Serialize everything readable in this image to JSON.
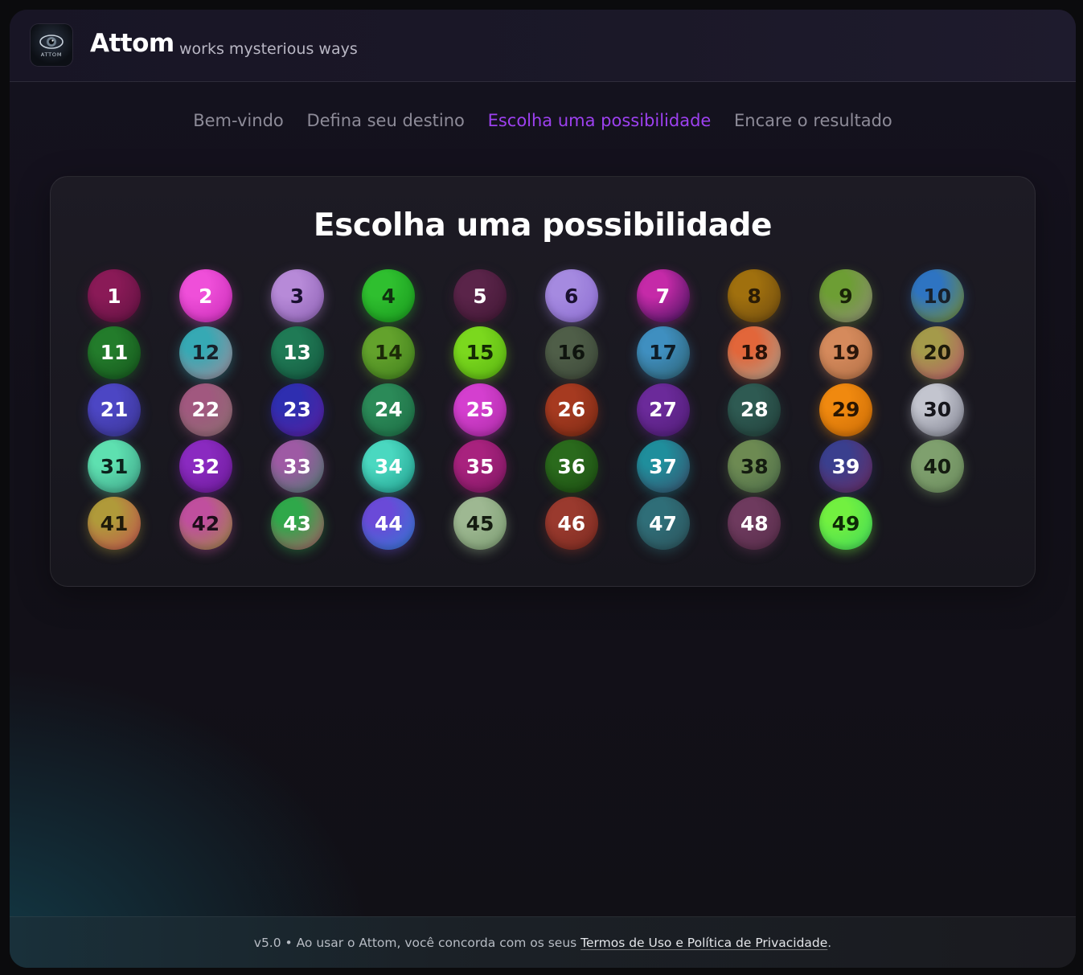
{
  "header": {
    "title": "Attom",
    "tagline": "works mysterious ways",
    "logo_text": "ATTOM"
  },
  "steps": [
    {
      "label": "Bem-vindo",
      "active": false
    },
    {
      "label": "Defina seu destino",
      "active": false
    },
    {
      "label": "Escolha uma possibilidade",
      "active": true
    },
    {
      "label": "Encare o resultado",
      "active": false
    }
  ],
  "main": {
    "title": "Escolha uma possibilidade",
    "balls": [
      {
        "number": "1",
        "colors": [
          "#8a1a57",
          "#5e1240"
        ],
        "text": "#ffffff"
      },
      {
        "number": "2",
        "colors": [
          "#ef4fd9",
          "#c72bb6"
        ],
        "text": "#ffffff"
      },
      {
        "number": "3",
        "colors": [
          "#b78ad8",
          "#8a5fb1"
        ],
        "text": "#1a1030"
      },
      {
        "number": "4",
        "colors": [
          "#2fbf2f",
          "#17961c"
        ],
        "text": "#103010"
      },
      {
        "number": "5",
        "colors": [
          "#5a2449",
          "#3f1733"
        ],
        "text": "#ffffff"
      },
      {
        "number": "6",
        "colors": [
          "#a58ae0",
          "#8b6cd0"
        ],
        "text": "#1a1030"
      },
      {
        "number": "7",
        "colors": [
          "#c52aa8",
          "#3b1258"
        ],
        "text": "#ffffff"
      },
      {
        "number": "8",
        "colors": [
          "#a0700e",
          "#6d4a10"
        ],
        "text": "#2a1c06"
      },
      {
        "number": "9",
        "colors": [
          "#6d9e34",
          "#8f8b78"
        ],
        "text": "#1a2208"
      },
      {
        "number": "10",
        "colors": [
          "#2e74c2",
          "#7a8e2a"
        ],
        "text": "#18202a"
      },
      {
        "number": "11",
        "colors": [
          "#237c2b",
          "#15531c"
        ],
        "text": "#ffffff"
      },
      {
        "number": "12",
        "colors": [
          "#36a9b4",
          "#a48a9a"
        ],
        "text": "#18202a"
      },
      {
        "number": "13",
        "colors": [
          "#1f7a55",
          "#14553d"
        ],
        "text": "#ffffff"
      },
      {
        "number": "14",
        "colors": [
          "#63a22c",
          "#3f7d1c"
        ],
        "text": "#1c2a08"
      },
      {
        "number": "15",
        "colors": [
          "#7bd81e",
          "#56b010"
        ],
        "text": "#142a04"
      },
      {
        "number": "16",
        "colors": [
          "#4f5e48",
          "#3b4638"
        ],
        "text": "#0f140e"
      },
      {
        "number": "17",
        "colors": [
          "#3f8fc0",
          "#2d5f6e"
        ],
        "text": "#0e1c26"
      },
      {
        "number": "18",
        "colors": [
          "#e2663a",
          "#a9a08f"
        ],
        "text": "#2a1208"
      },
      {
        "number": "19",
        "colors": [
          "#d58a5c",
          "#b06e45"
        ],
        "text": "#2a160a"
      },
      {
        "number": "20",
        "colors": [
          "#a49a4a",
          "#b5556a"
        ],
        "text": "#1e1a0a"
      },
      {
        "number": "21",
        "colors": [
          "#4c46c4",
          "#3a348f"
        ],
        "text": "#ffffff"
      },
      {
        "number": "22",
        "colors": [
          "#a1587f",
          "#8a6f70"
        ],
        "text": "#ffffff"
      },
      {
        "number": "23",
        "colors": [
          "#2e2eb0",
          "#5a1e9c"
        ],
        "text": "#ffffff"
      },
      {
        "number": "24",
        "colors": [
          "#2b8a58",
          "#1c6a43"
        ],
        "text": "#ffffff"
      },
      {
        "number": "25",
        "colors": [
          "#d43fcf",
          "#a82aa2"
        ],
        "text": "#ffffff"
      },
      {
        "number": "26",
        "colors": [
          "#a63a20",
          "#7a2a14"
        ],
        "text": "#ffffff"
      },
      {
        "number": "27",
        "colors": [
          "#6b2a9a",
          "#4e1c73"
        ],
        "text": "#ffffff"
      },
      {
        "number": "28",
        "colors": [
          "#2e5a52",
          "#223f3a"
        ],
        "text": "#ffffff"
      },
      {
        "number": "29",
        "colors": [
          "#f0890f",
          "#c86a06"
        ],
        "text": "#2a1602"
      },
      {
        "number": "30",
        "colors": [
          "#c3c5cf",
          "#7c7e8c"
        ],
        "text": "#16161c"
      },
      {
        "number": "31",
        "colors": [
          "#5ee0b0",
          "#3d9f86"
        ],
        "text": "#0c221c"
      },
      {
        "number": "32",
        "colors": [
          "#8a2ac0",
          "#6a1a96"
        ],
        "text": "#ffffff"
      },
      {
        "number": "33",
        "colors": [
          "#9e5aa4",
          "#4c7a6e"
        ],
        "text": "#ffffff"
      },
      {
        "number": "34",
        "colors": [
          "#4ad8c0",
          "#1f9a8a"
        ],
        "text": "#ffffff"
      },
      {
        "number": "35",
        "colors": [
          "#a8227e",
          "#7c1760"
        ],
        "text": "#ffffff"
      },
      {
        "number": "36",
        "colors": [
          "#2a6a1c",
          "#1c4d12"
        ],
        "text": "#ffffff"
      },
      {
        "number": "37",
        "colors": [
          "#1f8e9c",
          "#3a4d6a"
        ],
        "text": "#ffffff"
      },
      {
        "number": "38",
        "colors": [
          "#6d8a52",
          "#4c6c4a"
        ],
        "text": "#141c10"
      },
      {
        "number": "39",
        "colors": [
          "#3a3f8e",
          "#6a2a5e"
        ],
        "text": "#ffffff"
      },
      {
        "number": "40",
        "colors": [
          "#7fa06e",
          "#6a8a5c"
        ],
        "text": "#141c10"
      },
      {
        "number": "41",
        "colors": [
          "#b09a3a",
          "#c0504f"
        ],
        "text": "#1e1a0a"
      },
      {
        "number": "42",
        "colors": [
          "#c04f9e",
          "#9a8a3e"
        ],
        "text": "#1e0e1a"
      },
      {
        "number": "43",
        "colors": [
          "#2fa84a",
          "#b05a6a"
        ],
        "text": "#ffffff"
      },
      {
        "number": "44",
        "colors": [
          "#6a4ad8",
          "#2f7ad0"
        ],
        "text": "#ffffff"
      },
      {
        "number": "45",
        "colors": [
          "#9eb892",
          "#7a9a70"
        ],
        "text": "#141c10"
      },
      {
        "number": "46",
        "colors": [
          "#9a3a2e",
          "#7a2a20"
        ],
        "text": "#ffffff"
      },
      {
        "number": "47",
        "colors": [
          "#2f6e78",
          "#2c5058"
        ],
        "text": "#ffffff"
      },
      {
        "number": "48",
        "colors": [
          "#6e3a5e",
          "#552c48"
        ],
        "text": "#ffffff"
      },
      {
        "number": "49",
        "colors": [
          "#72f040",
          "#3ed85a"
        ],
        "text": "#0e2a06"
      }
    ]
  },
  "footer": {
    "text": "v5.0 • Ao usar o Attom, você concorda com os seus ",
    "link": "Termos de Uso e Política de Privacidade",
    "end": "."
  }
}
